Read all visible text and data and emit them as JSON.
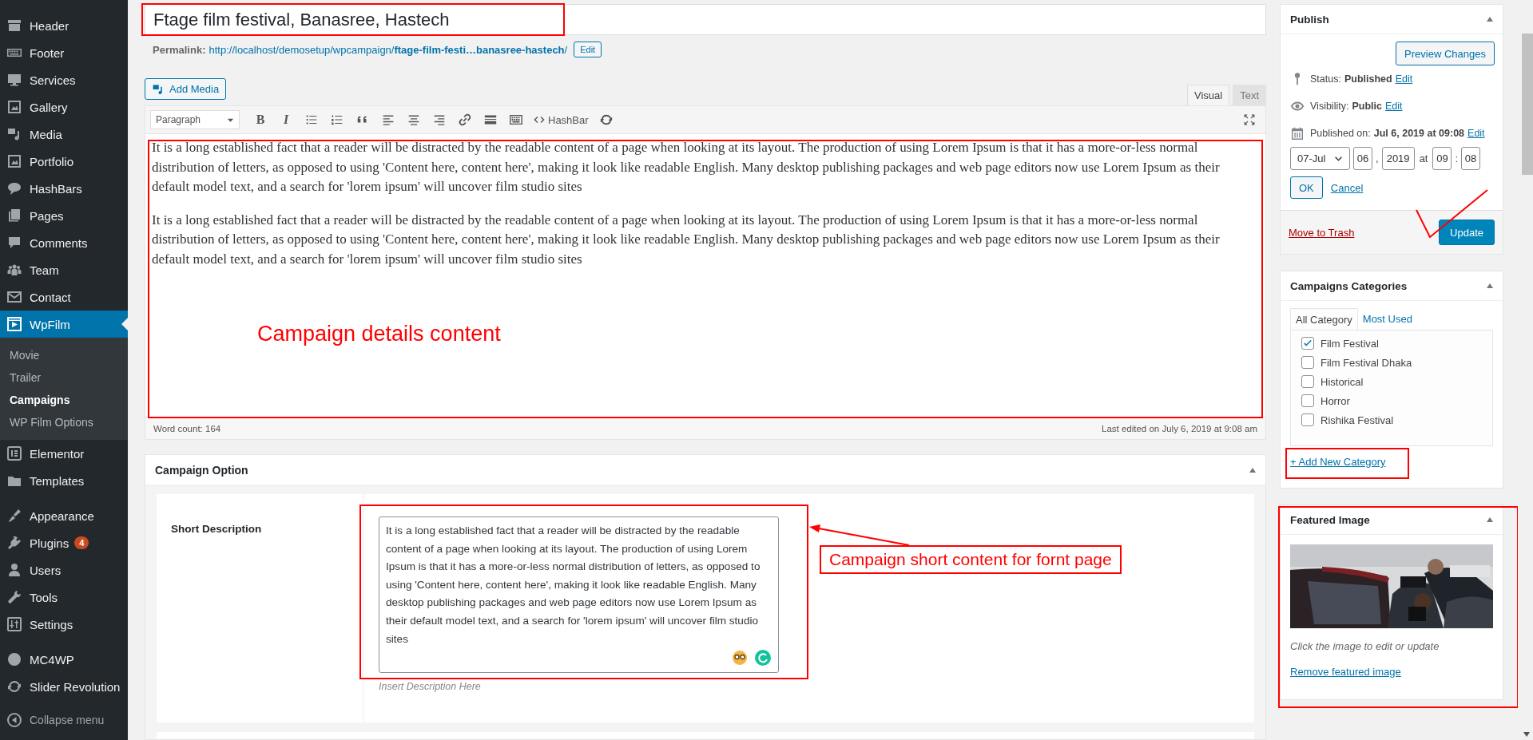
{
  "sidebar": {
    "groups": [
      {
        "items": [
          {
            "label": "Header",
            "selected": false
          },
          {
            "label": "Footer",
            "selected": false
          },
          {
            "label": "Services",
            "selected": false
          },
          {
            "label": "Gallery",
            "selected": false
          },
          {
            "label": "Media",
            "selected": false
          },
          {
            "label": "Portfolio",
            "selected": false
          },
          {
            "label": "HashBars",
            "selected": false
          },
          {
            "label": "Pages",
            "selected": false
          },
          {
            "label": "Comments",
            "selected": false
          },
          {
            "label": "Team",
            "selected": false
          },
          {
            "label": "Contact",
            "selected": false
          },
          {
            "label": "WpFilm",
            "selected": true,
            "children": [
              {
                "label": "Movie",
                "selected": false
              },
              {
                "label": "Trailer",
                "selected": false
              },
              {
                "label": "Campaigns",
                "selected": true
              },
              {
                "label": "WP Film Options",
                "selected": false
              }
            ]
          },
          {
            "label": "Elementor",
            "selected": false
          },
          {
            "label": "Templates",
            "selected": false
          }
        ]
      },
      {
        "items": [
          {
            "label": "Appearance",
            "selected": false
          },
          {
            "label": "Plugins",
            "selected": false,
            "badge": "4"
          },
          {
            "label": "Users",
            "selected": false
          },
          {
            "label": "Tools",
            "selected": false
          },
          {
            "label": "Settings",
            "selected": false
          }
        ]
      },
      {
        "items": [
          {
            "label": "MC4WP",
            "selected": false
          },
          {
            "label": "Slider Revolution",
            "selected": false
          }
        ]
      }
    ],
    "collapse_label": "Collapse menu"
  },
  "editor": {
    "title": {
      "value": "Ftage film festival, Banasree, Hastech"
    },
    "permalink": {
      "label": "Permalink:",
      "url": "http://localhost/demosetup/wpcampaign/**ftage-film-festi…banasree-hastech**/",
      "edit_button": "Edit"
    },
    "add_media": "Add Media",
    "tabs": [
      {
        "label": "Visual",
        "selected": true
      },
      {
        "label": "Text",
        "selected": false
      }
    ],
    "toolbar": {
      "format": "Paragraph",
      "bold": "B",
      "italic": "I",
      "hashbar": "HashBar"
    },
    "paragraphs": [
      "It is a long established fact that a reader will be distracted by the readable content of a page when looking at its layout. The production of using Lorem Ipsum is that it has a more-or-less normal distribution of letters, as opposed to using 'Content here, content here', making it look like readable English. Many desktop publishing packages and web page editors now use Lorem Ipsum as their default model text, and a search for 'lorem ipsum' will uncover film studio sites",
      "It is a long established fact that a reader will be distracted by the readable content of a page when looking at its layout. The production of using Lorem Ipsum is that it has a more-or-less normal distribution of letters, as opposed to using 'Content here, content here', making it look like readable English. Many desktop publishing packages and web page editors now use Lorem Ipsum as their default model text, and a search for 'lorem ipsum' will uncover film studio sites"
    ],
    "word_count": "Word count: 164",
    "last_edited": "Last edited on July 6, 2019 at 9:08 am"
  },
  "campaign_option": {
    "title": "Campaign Option",
    "fields": [
      {
        "label": "Short Description",
        "value": "It is a long established fact that a reader will be distracted by the readable content of a page when looking at its layout. The production of using Lorem Ipsum is that it has a more-or-less normal distribution of letters, as opposed to using 'Content here, content here', making it look like readable English. Many desktop publishing packages and web page editors now use Lorem Ipsum as their default model text, and a search for 'lorem ipsum' will uncover film studio sites",
        "hint": "Insert Description Here"
      }
    ]
  },
  "annotations": [
    {
      "text": "Campaign details content"
    },
    {
      "text": "Campaign short content for fornt page"
    }
  ],
  "publish": {
    "title": "Publish",
    "preview_button": "Preview Changes",
    "status_label": "Status:",
    "status": "Published",
    "visibility_label": "Visibility:",
    "visibility": "Public",
    "published_label": "Published on:",
    "published": "Jul 6, 2019 at 09:08",
    "status_edit": "Edit",
    "visibility_edit": "Edit",
    "published_edit": "Edit",
    "date": {
      "month": "07-Jul",
      "day": "06",
      "day_separator": ",",
      "year": "2019",
      "at": "at",
      "hour": "09",
      "time_separator": ":",
      "minute": "08"
    },
    "ok_button": "OK",
    "cancel_link": "Cancel",
    "trash_link": "Move to Trash",
    "update_button": "Update"
  },
  "categories": {
    "title": "Campaigns Categories",
    "tabs": [
      {
        "label": "All Category",
        "selected": true
      },
      {
        "label": "Most Used",
        "selected": false
      }
    ],
    "items": [
      {
        "label": "Film Festival",
        "checked": true
      },
      {
        "label": "Film Festival Dhaka",
        "checked": false
      },
      {
        "label": "Historical",
        "checked": false
      },
      {
        "label": "Horror",
        "checked": false
      },
      {
        "label": "Rishika Festival",
        "checked": false
      }
    ],
    "add_link": "+ Add New Category"
  },
  "featured_image": {
    "title": "Featured Image",
    "caption": "Click the image to edit or update",
    "remove_link": "Remove featured image"
  }
}
